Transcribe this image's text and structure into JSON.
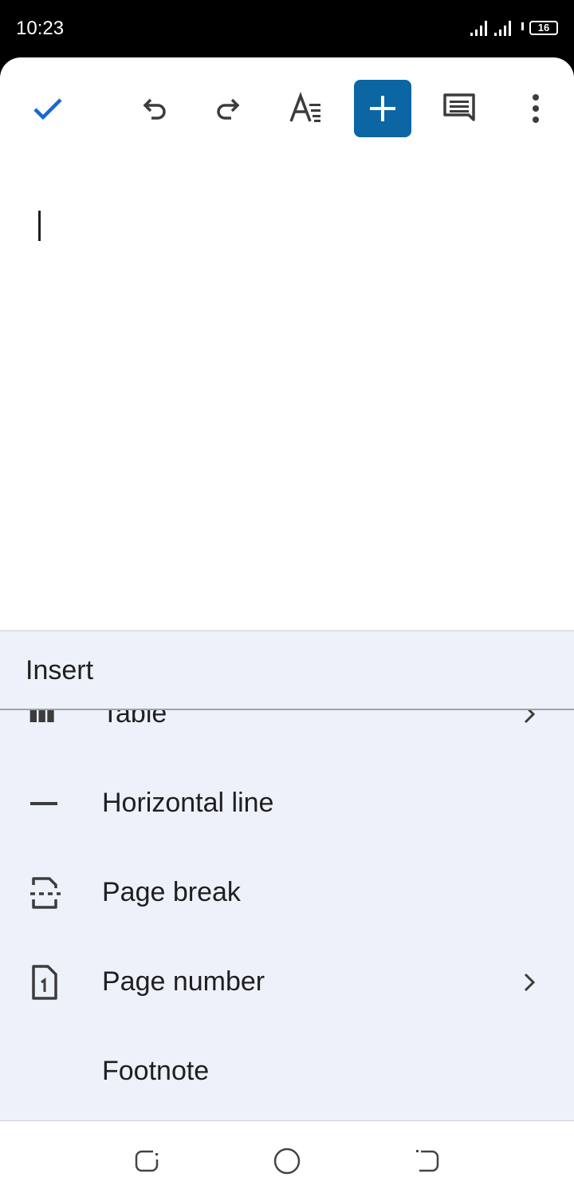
{
  "status_bar": {
    "time": "10:23",
    "battery": "16",
    "icons": [
      "signal-icon",
      "signal-icon",
      "wifi-icon",
      "battery-icon"
    ]
  },
  "toolbar": {
    "icons": [
      "check-icon",
      "undo-icon",
      "redo-icon",
      "text-format-icon",
      "add-icon",
      "comment-icon",
      "more-vert-icon"
    ],
    "accent": "#1a66d2",
    "active_bg": "#0b66a3"
  },
  "sheet": {
    "title": "Insert",
    "background": "#edf1f9",
    "items": [
      {
        "label": "Table",
        "icon": "table-icon",
        "has_submenu": true
      },
      {
        "label": "Horizontal line",
        "icon": "horizontal-line-icon",
        "has_submenu": false
      },
      {
        "label": "Page break",
        "icon": "page-break-icon",
        "has_submenu": false
      },
      {
        "label": "Page number",
        "icon": "page-number-icon",
        "has_submenu": true
      },
      {
        "label": "Footnote",
        "icon": "",
        "has_submenu": false
      }
    ]
  },
  "nav_bar": {
    "icons": [
      "recent-apps-icon",
      "home-icon",
      "back-icon"
    ]
  }
}
